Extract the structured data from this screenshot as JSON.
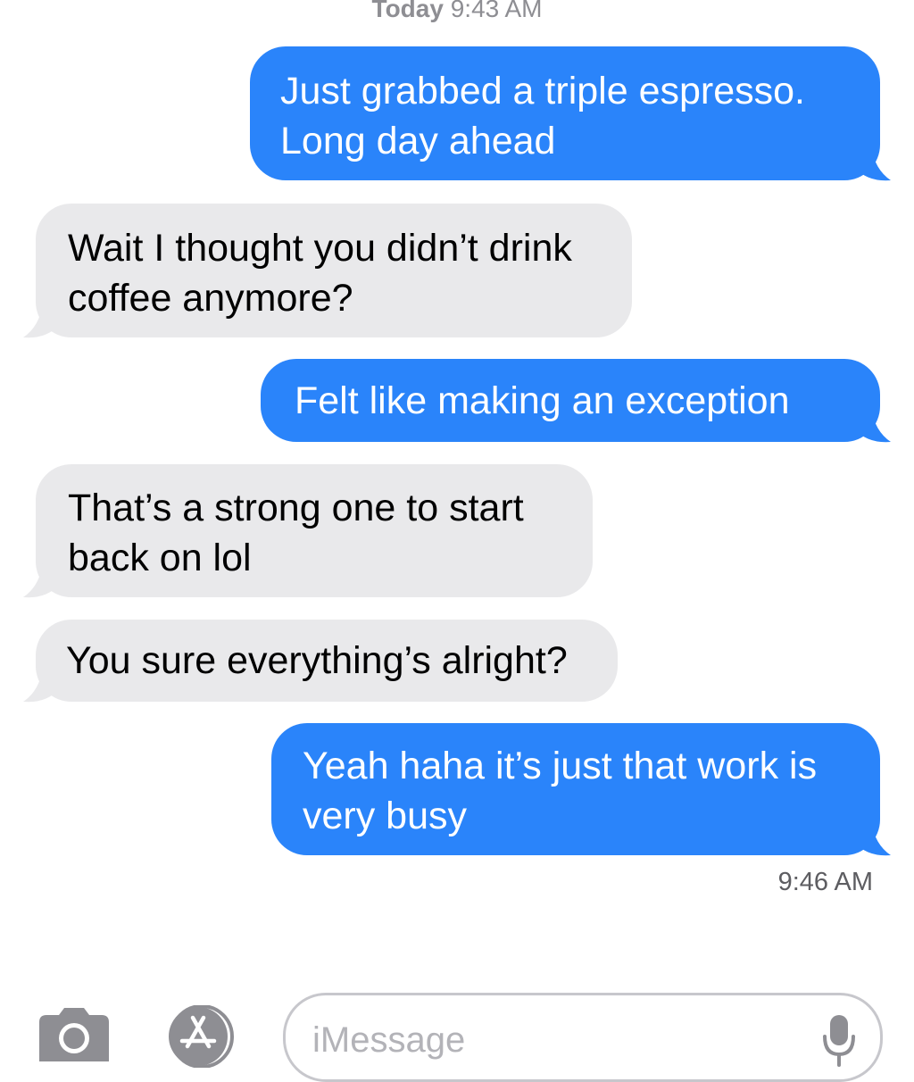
{
  "header": {
    "day": "Today",
    "time": "9:43 AM"
  },
  "messages": [
    {
      "direction": "outgoing",
      "lines": [
        "Just grabbed a triple espresso.",
        "Long day ahead"
      ]
    },
    {
      "direction": "incoming",
      "lines": [
        "Wait I thought you didn’t drink",
        "coffee anymore?"
      ]
    },
    {
      "direction": "outgoing",
      "lines": [
        "Felt like making an exception"
      ]
    },
    {
      "direction": "incoming",
      "lines": [
        "That’s a strong one to start",
        "back on lol"
      ]
    },
    {
      "direction": "incoming",
      "lines": [
        "You sure everything’s alright?"
      ]
    },
    {
      "direction": "outgoing",
      "lines": [
        "Yeah haha it’s just that work is",
        "very busy"
      ]
    }
  ],
  "delivered_time": "9:46 AM",
  "composer": {
    "placeholder": "iMessage",
    "camera_icon": "camera-icon",
    "apps_icon": "app-store-icon",
    "mic_icon": "microphone-icon"
  },
  "colors": {
    "outgoing_bubble": "#2a84fa",
    "incoming_bubble": "#e9e9eb",
    "timestamp": "#8e8e93",
    "icon_gray": "#8e8e93"
  }
}
